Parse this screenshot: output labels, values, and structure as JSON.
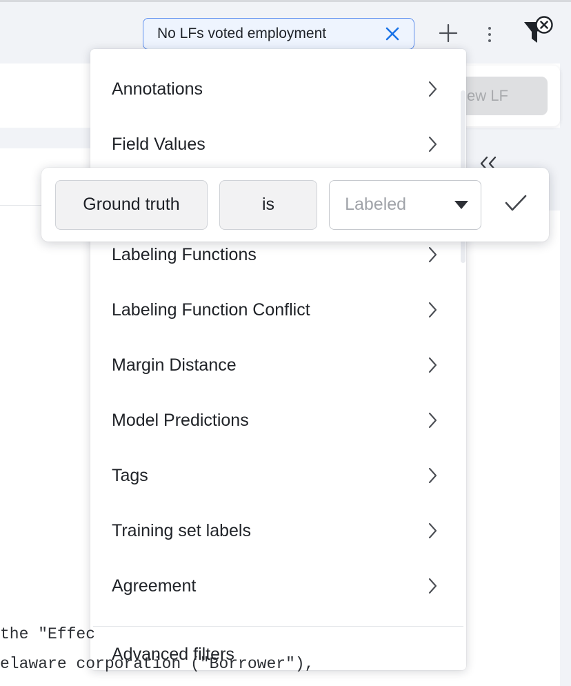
{
  "toolbar": {
    "filter_chip": {
      "label": "No LFs voted employment",
      "close_icon": "close-x-icon"
    },
    "add_button_icon": "plus-icon",
    "more_button_icon": "kebab-menu-icon",
    "clear_filters_icon": "filter-remove-icon"
  },
  "background": {
    "new_lf_button": "New LF",
    "collapse_icon": "chevrons-left-icon",
    "document_lines": [
      "the \"Effec",
      "elaware corporation (\"Borrower\"),"
    ]
  },
  "filter_menu": {
    "items": [
      {
        "label": "Annotations",
        "chevron": "chevron-right-icon",
        "highlighted": false,
        "has_chevron": true
      },
      {
        "label": "Field Values",
        "chevron": "chevron-right-icon",
        "highlighted": true,
        "has_chevron": true
      },
      {
        "label": "Ground truth",
        "chevron": "chevron-right-icon",
        "highlighted": false,
        "has_chevron": true
      },
      {
        "label": "Labeling Functions",
        "chevron": "chevron-right-icon",
        "highlighted": false,
        "has_chevron": true
      },
      {
        "label": "Labeling Function Conflict",
        "chevron": "chevron-right-icon",
        "highlighted": false,
        "has_chevron": true
      },
      {
        "label": "Margin Distance",
        "chevron": "chevron-right-icon",
        "highlighted": false,
        "has_chevron": true
      },
      {
        "label": "Model Predictions",
        "chevron": "chevron-right-icon",
        "highlighted": false,
        "has_chevron": true
      },
      {
        "label": "Tags",
        "chevron": "chevron-right-icon",
        "highlighted": false,
        "has_chevron": true
      },
      {
        "label": "Training set labels",
        "chevron": "chevron-right-icon",
        "highlighted": false,
        "has_chevron": true
      },
      {
        "label": "Agreement",
        "chevron": "chevron-right-icon",
        "highlighted": false,
        "has_chevron": true
      },
      {
        "label": "Advanced filters",
        "chevron": "",
        "highlighted": false,
        "has_chevron": false
      }
    ]
  },
  "condition_builder": {
    "subject": "Ground truth",
    "operator": "is",
    "value_placeholder": "Labeled",
    "value_caret_icon": "caret-down-icon",
    "confirm_icon": "check-icon"
  },
  "colors": {
    "accent_blue": "#1b5fd9",
    "chip_border": "#5b8dee",
    "chip_fill": "#eef4fe",
    "panel_bg": "#f1f3f7"
  }
}
